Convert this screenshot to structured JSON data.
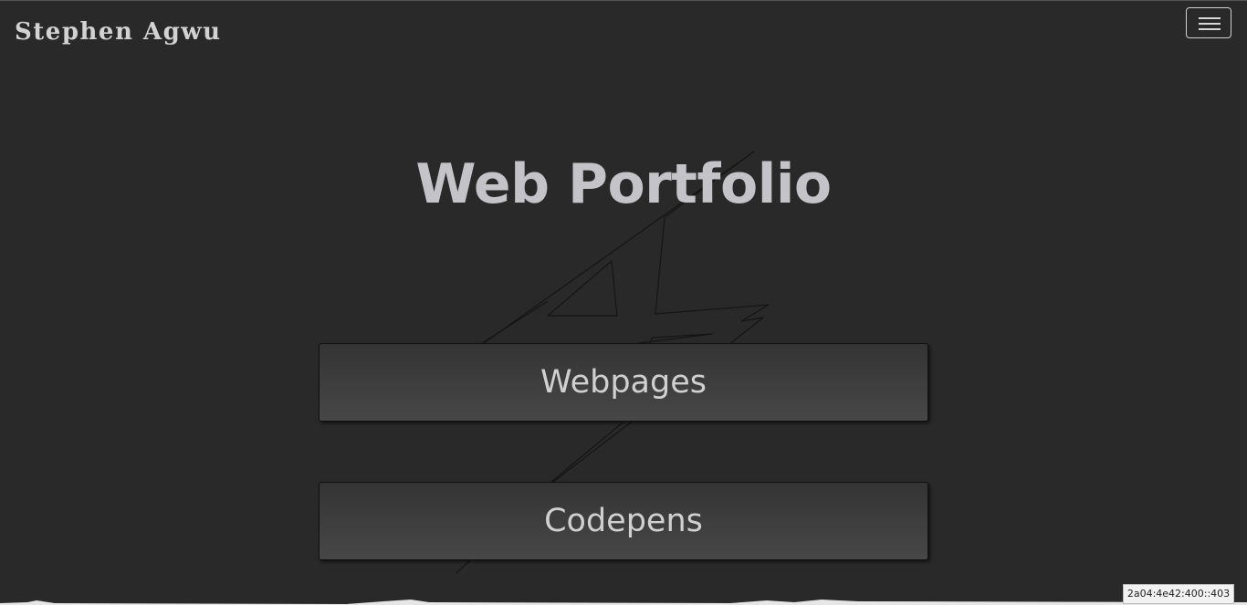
{
  "header": {
    "brand": "Stephen Agwu",
    "menu_icon": "hamburger-menu-icon"
  },
  "main": {
    "title": "Web Portfolio",
    "background_logo": "sketched-letter-mark-logo",
    "buttons": [
      {
        "label": "Webpages"
      },
      {
        "label": "Codepens"
      }
    ]
  },
  "status": {
    "ip_address": "2a04:4e42:400::403"
  },
  "colors": {
    "background": "#292929",
    "text": "#c4c4c8",
    "button_top": "#343434",
    "button_bottom": "#474747"
  }
}
